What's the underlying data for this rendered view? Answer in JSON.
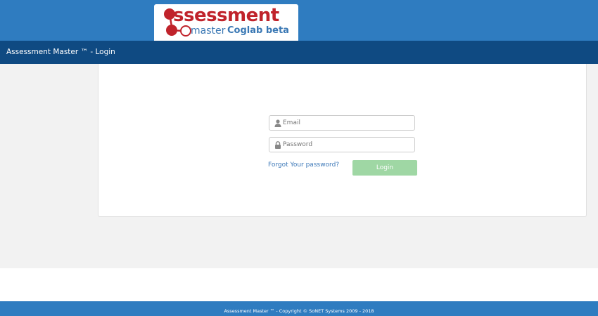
{
  "header": {
    "logo": {
      "word": "ssessment",
      "master": "master",
      "subtitle": "Coglab beta",
      "icon": "molecule-logo-icon"
    }
  },
  "title_bar": {
    "title": "Assessment Master ™ - Login"
  },
  "login_form": {
    "email": {
      "placeholder": "Email",
      "value": "",
      "icon": "user-icon"
    },
    "password": {
      "placeholder": "Password",
      "value": "",
      "icon": "lock-icon"
    },
    "forgot_link": "Forgot Your password?",
    "login_button": "Login"
  },
  "footer": {
    "text": "Assessment Master ™ - Copyright © SoNET Systems 2009 - 2018"
  },
  "colors": {
    "top_band": "#2f7cc0",
    "title_bar": "#0f4a82",
    "logo_red": "#c0232b",
    "logo_blue": "#3a78b4",
    "login_button": "#9fd7a4",
    "link": "#3d78b8"
  }
}
